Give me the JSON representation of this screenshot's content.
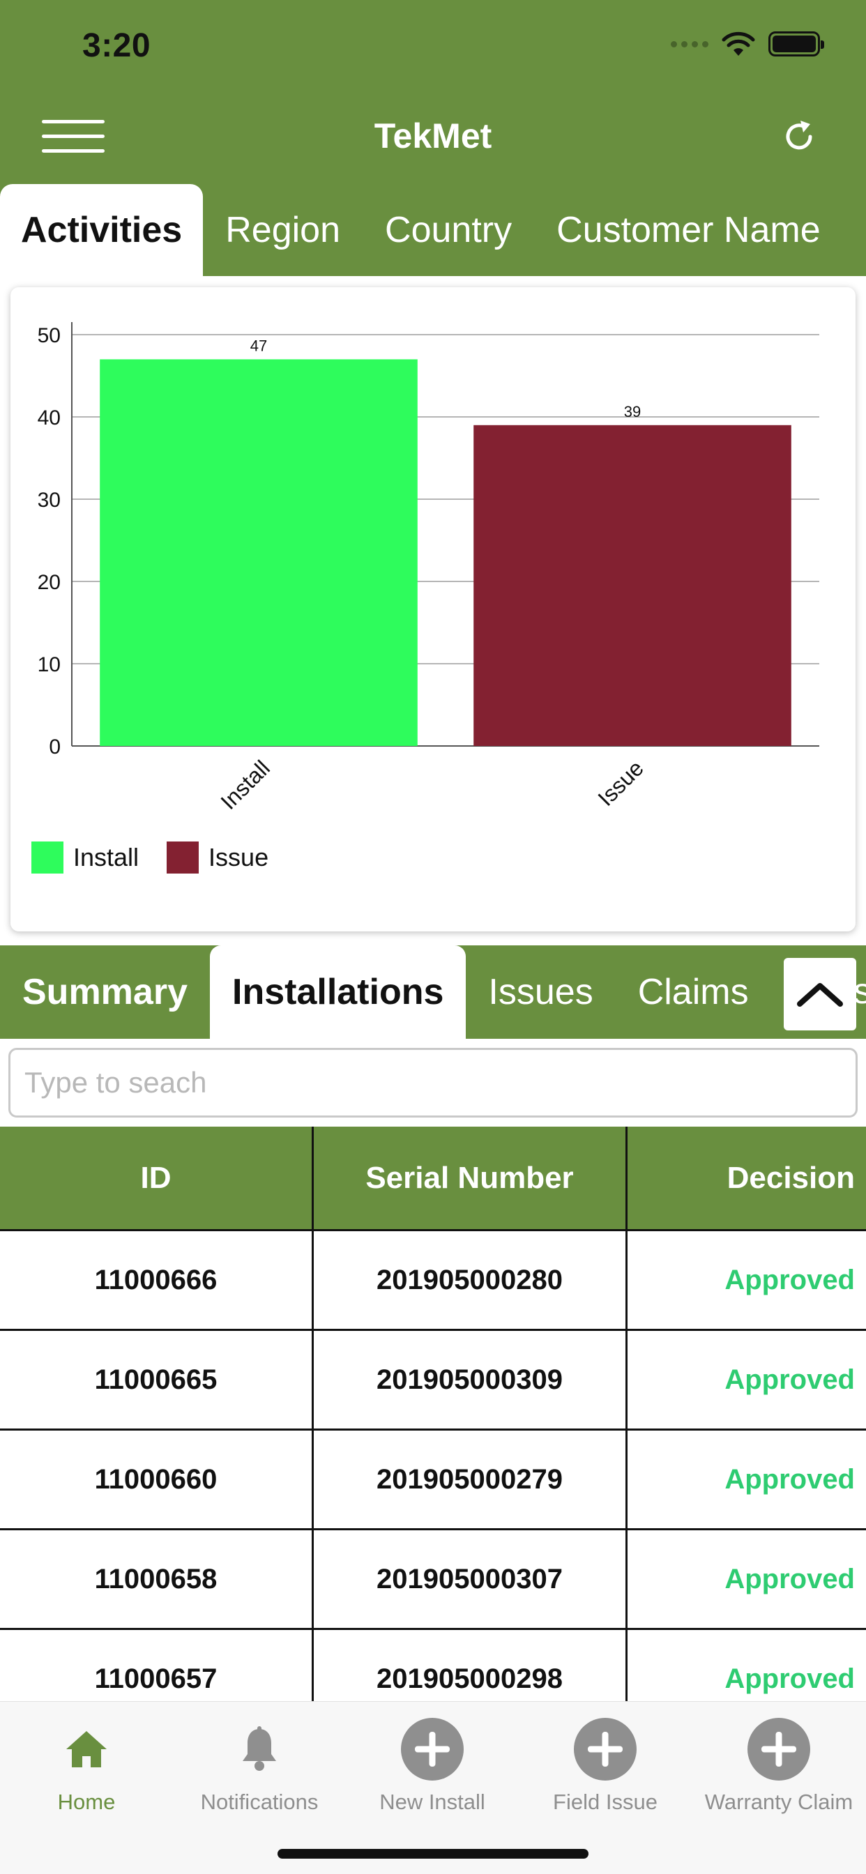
{
  "status_bar": {
    "time": "3:20"
  },
  "header": {
    "title": "TekMet"
  },
  "top_tabs": [
    {
      "label": "Activities",
      "active": true
    },
    {
      "label": "Region",
      "active": false
    },
    {
      "label": "Country",
      "active": false
    },
    {
      "label": "Customer Name",
      "active": false
    }
  ],
  "chart_data": {
    "type": "bar",
    "categories": [
      "Install",
      "Issue"
    ],
    "values": [
      47,
      39
    ],
    "colors": [
      "#2efc5c",
      "#832131"
    ],
    "ylim": [
      0,
      50
    ],
    "yticks": [
      0,
      10,
      20,
      30,
      40,
      50
    ],
    "grid": true,
    "legend": {
      "position": "bottom-left",
      "entries": [
        "Install",
        "Issue"
      ]
    }
  },
  "bottom_tabs": [
    {
      "label": "Summary",
      "active": false
    },
    {
      "label": "Installations",
      "active": true
    },
    {
      "label": "Issues",
      "active": false
    },
    {
      "label": "Claims",
      "active": false
    }
  ],
  "overflow_tab_fragment": "s",
  "search": {
    "placeholder": "Type to seach"
  },
  "table": {
    "headers": [
      "ID",
      "Serial Number",
      "Decision"
    ],
    "rows": [
      [
        "11000666",
        "201905000280",
        "Approved"
      ],
      [
        "11000665",
        "201905000309",
        "Approved"
      ],
      [
        "11000660",
        "201905000279",
        "Approved"
      ],
      [
        "11000658",
        "201905000307",
        "Approved"
      ],
      [
        "11000657",
        "201905000298",
        "Approved"
      ]
    ],
    "decision_color": "#2ecc71"
  },
  "bottom_nav": [
    {
      "label": "Home",
      "icon": "home-icon",
      "active": true
    },
    {
      "label": "Notifications",
      "icon": "bell-icon",
      "active": false
    },
    {
      "label": "New Install",
      "icon": "plus-circle-icon",
      "active": false
    },
    {
      "label": "Field Issue",
      "icon": "plus-circle-icon",
      "active": false
    },
    {
      "label": "Warranty Claim",
      "icon": "plus-circle-icon",
      "active": false
    }
  ],
  "colors": {
    "brand_green": "#698f3f",
    "approved": "#2ecc71"
  }
}
